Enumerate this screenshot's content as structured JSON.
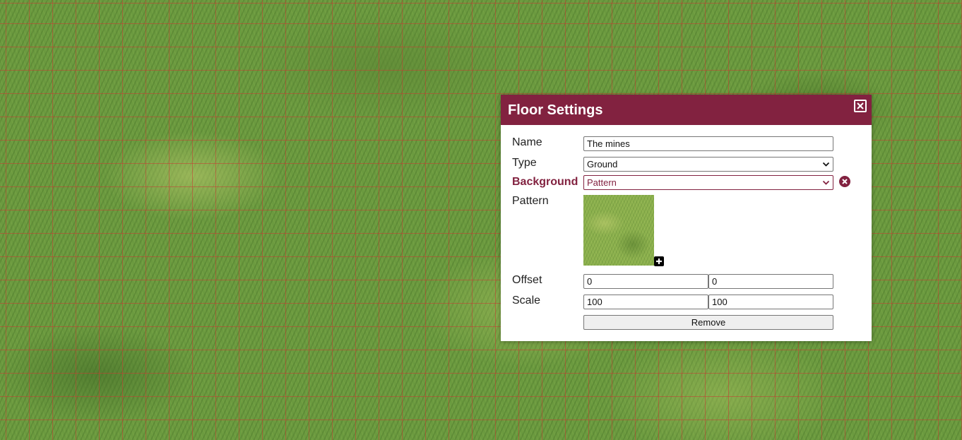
{
  "dialog": {
    "title": "Floor Settings",
    "close_icon": "close-icon"
  },
  "fields": {
    "name": {
      "label": "Name",
      "value": "The mines"
    },
    "type": {
      "label": "Type",
      "value": "Ground"
    },
    "background": {
      "label": "Background",
      "value": "Pattern",
      "remove_icon": "remove-circle-icon"
    },
    "pattern": {
      "label": "Pattern",
      "add_icon": "plus-icon"
    },
    "offset": {
      "label": "Offset",
      "x": "0",
      "y": "0"
    },
    "scale": {
      "label": "Scale",
      "x": "100",
      "y": "100"
    }
  },
  "buttons": {
    "remove_label": "Remove"
  },
  "colors": {
    "accent": "#822240",
    "grass": "#6b9a3f",
    "grid_line": "#c83c32"
  }
}
